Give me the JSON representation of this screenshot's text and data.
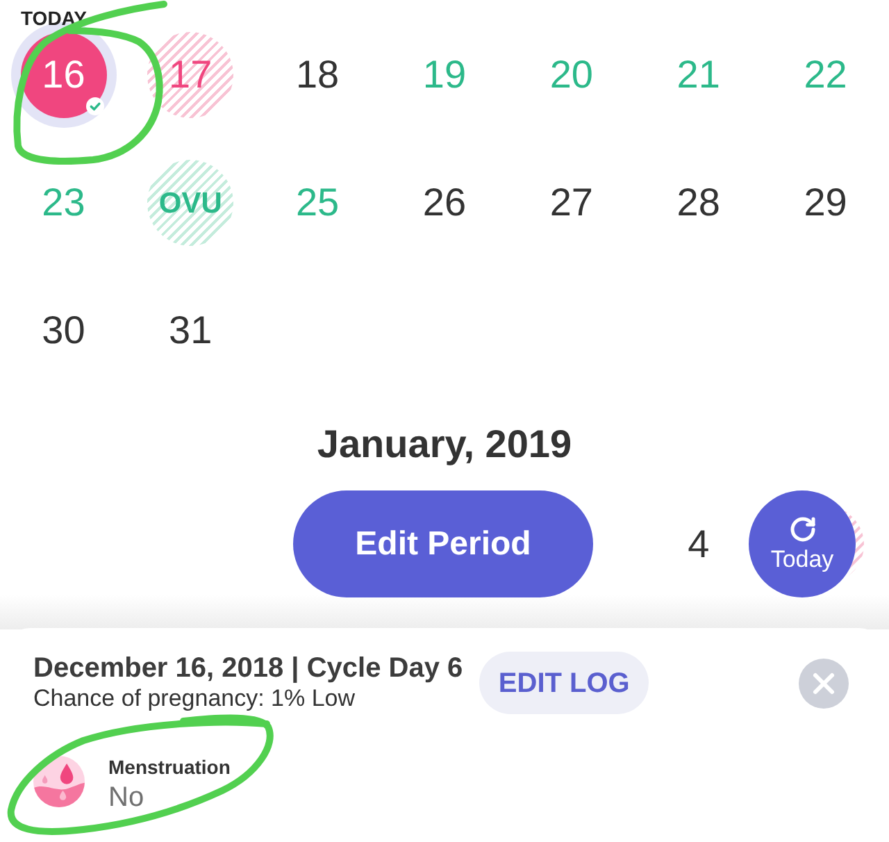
{
  "calendar": {
    "today_label": "TODAY",
    "weeks": [
      [
        {
          "day": "16",
          "kind": "period",
          "selected": true,
          "logged": true,
          "today": true
        },
        {
          "day": "17",
          "kind": "predicted_period",
          "selected": false,
          "logged": false,
          "today": false
        },
        {
          "day": "18",
          "kind": "normal",
          "selected": false,
          "logged": false,
          "today": false
        },
        {
          "day": "19",
          "kind": "fertile",
          "selected": false,
          "logged": false,
          "today": false
        },
        {
          "day": "20",
          "kind": "fertile",
          "selected": false,
          "logged": false,
          "today": false
        },
        {
          "day": "21",
          "kind": "fertile",
          "selected": false,
          "logged": false,
          "today": false
        },
        {
          "day": "22",
          "kind": "fertile",
          "selected": false,
          "logged": false,
          "today": false
        }
      ],
      [
        {
          "day": "23",
          "kind": "fertile",
          "selected": false,
          "logged": false,
          "today": false
        },
        {
          "day": "OVU",
          "kind": "ovulation",
          "selected": false,
          "logged": false,
          "today": false
        },
        {
          "day": "25",
          "kind": "fertile",
          "selected": false,
          "logged": false,
          "today": false
        },
        {
          "day": "26",
          "kind": "normal",
          "selected": false,
          "logged": false,
          "today": false
        },
        {
          "day": "27",
          "kind": "normal",
          "selected": false,
          "logged": false,
          "today": false
        },
        {
          "day": "28",
          "kind": "normal",
          "selected": false,
          "logged": false,
          "today": false
        },
        {
          "day": "29",
          "kind": "normal",
          "selected": false,
          "logged": false,
          "today": false
        }
      ],
      [
        {
          "day": "30",
          "kind": "normal",
          "selected": false,
          "logged": false,
          "today": false
        },
        {
          "day": "31",
          "kind": "normal",
          "selected": false,
          "logged": false,
          "today": false
        }
      ]
    ]
  },
  "next_month": {
    "title": "January, 2019",
    "week": [
      {
        "kind": "blank"
      },
      {
        "kind": "blank"
      },
      {
        "kind": "blank"
      },
      {
        "kind": "blank"
      },
      {
        "kind": "blank"
      },
      {
        "day": "4",
        "kind": "normal",
        "selected": false,
        "logged": false,
        "today": false
      },
      {
        "kind": "predicted_period"
      }
    ]
  },
  "actions": {
    "edit_period": "Edit Period",
    "today": "Today"
  },
  "day_sheet": {
    "date_line": "December 16, 2018 | Cycle Day 6",
    "pregnancy_chance": "Chance of pregnancy: 1% Low",
    "edit_log": "EDIT LOG",
    "entries": [
      {
        "kind": "menstruation",
        "label": "Menstruation",
        "value": "No"
      }
    ]
  },
  "annotations": [
    {
      "kind": "hand_drawn_loop"
    },
    {
      "kind": "hand_drawn_loop"
    }
  ]
}
